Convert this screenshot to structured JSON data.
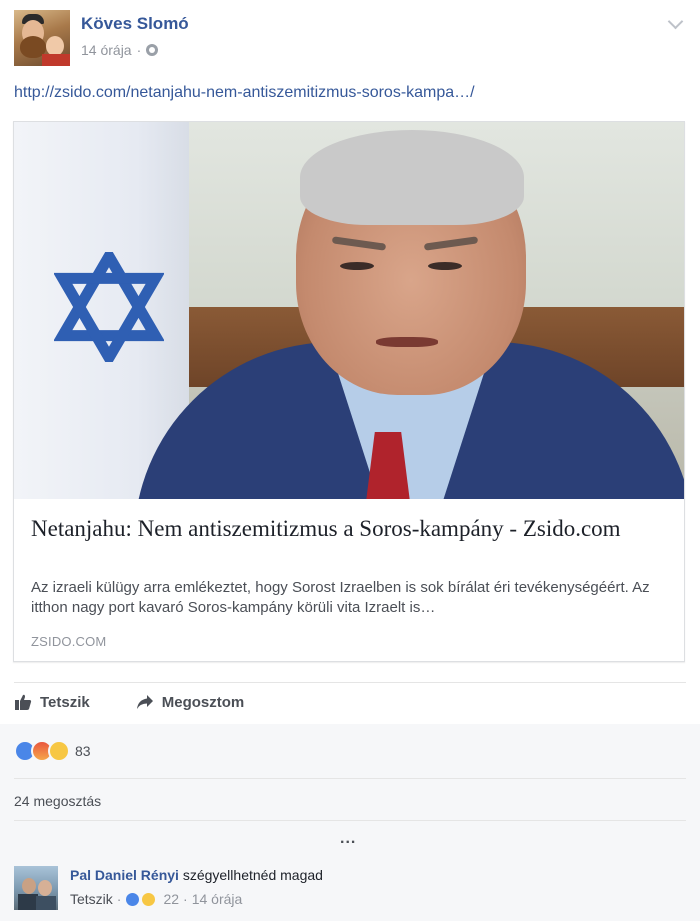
{
  "post": {
    "author": "Köves Slomó",
    "time": "14 órája",
    "separator": "·",
    "link_text": "http://zsido.com/netanjahu-nem-antiszemitizmus-soros-kampa…/",
    "privacy_icon": "globe-icon",
    "options_icon": "chevron-down-icon"
  },
  "card": {
    "title": "Netanjahu: Nem antiszemitizmus a Soros-kampány - Zsido.com",
    "description": "Az izraeli külügy arra emlékeztet, hogy Sorost Izraelben is sok bírálat éri tevékenységéért. Az itthon nagy port kavaró Soros-kampány körüli vita Izraelt is…",
    "domain": "ZSIDO.COM"
  },
  "actions": {
    "like_label": "Tetszik",
    "share_label": "Megosztom"
  },
  "reactions": {
    "icons": [
      "like-reaction-icon",
      "angry-reaction-icon",
      "sad-reaction-icon"
    ],
    "count": "83"
  },
  "shares": "24 megosztás",
  "more_comments": "...",
  "comment": {
    "author": "Pal Daniel Rényi",
    "text": "szégyellhetnéd magad",
    "like_label": "Tetszik",
    "separator": "·",
    "reaction_count": "22",
    "time": "14 órája"
  },
  "colors": {
    "link_blue": "#365899",
    "like_blue": "#4a86e8",
    "tie_red": "#b0232c",
    "suit_navy": "#2b3f77"
  }
}
